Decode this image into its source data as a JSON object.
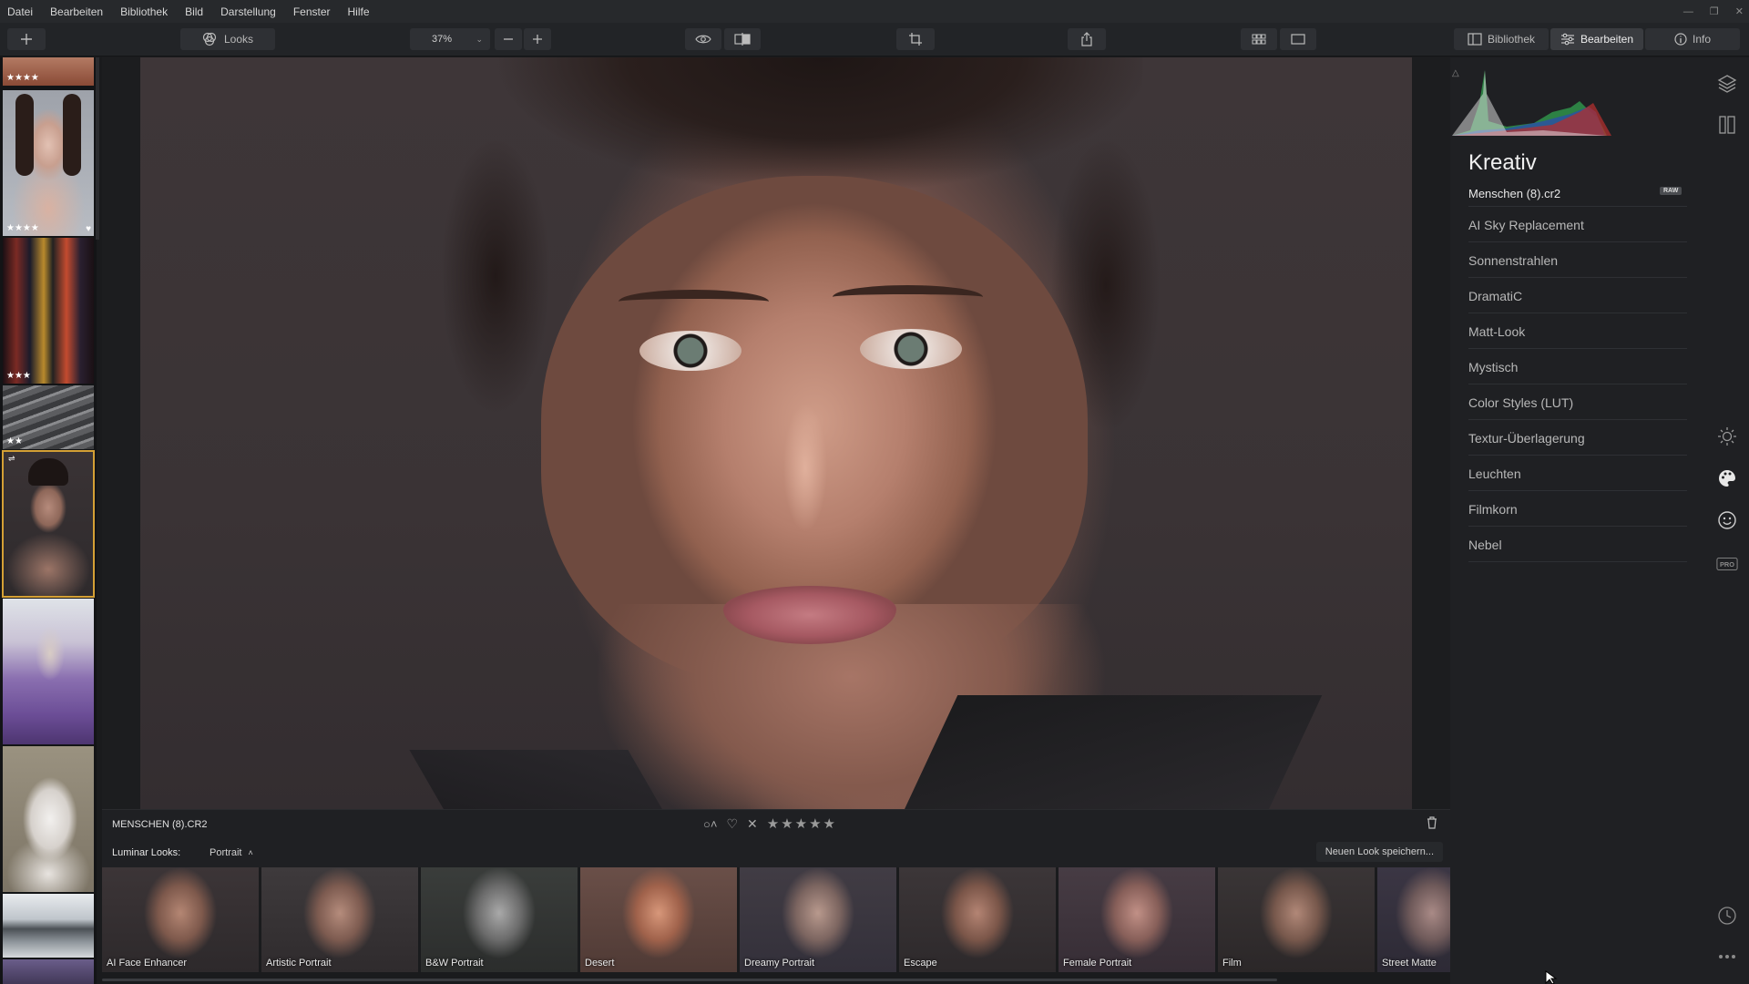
{
  "menu": [
    "Datei",
    "Bearbeiten",
    "Bibliothek",
    "Bild",
    "Darstellung",
    "Fenster",
    "Hilfe"
  ],
  "toolbar": {
    "looks_label": "Looks",
    "zoom_value": "37%",
    "mode_library": "Bibliothek",
    "mode_edit": "Bearbeiten",
    "mode_info": "Info"
  },
  "filmstrip": [
    {
      "stars": "★★★★",
      "selected": false
    },
    {
      "stars": "★★★★",
      "heart": "♥",
      "selected": false
    },
    {
      "stars": "★★★",
      "selected": false
    },
    {
      "stars": "★★",
      "selected": false
    },
    {
      "stars": "",
      "selected": true
    },
    {
      "stars": "",
      "selected": false
    },
    {
      "stars": "",
      "selected": false
    },
    {
      "stars": "",
      "selected": false
    },
    {
      "stars": "",
      "selected": false
    }
  ],
  "infobar": {
    "filename": "MENSCHEN (8).CR2"
  },
  "looksbar": {
    "label": "Luminar Looks:",
    "category": "Portrait",
    "save_button": "Neuen Look speichern..."
  },
  "looks": [
    {
      "name": "AI Face Enhancer"
    },
    {
      "name": "Artistic Portrait"
    },
    {
      "name": "B&W Portrait"
    },
    {
      "name": "Desert"
    },
    {
      "name": "Dreamy Portrait"
    },
    {
      "name": "Escape"
    },
    {
      "name": "Female Portrait"
    },
    {
      "name": "Film"
    },
    {
      "name": "Street Matte"
    }
  ],
  "panel": {
    "title": "Kreativ",
    "filename": "Menschen (8).cr2",
    "raw_badge": "RAW",
    "tools": [
      "AI Sky Replacement",
      "Sonnenstrahlen",
      "DramatiC",
      "Matt-Look",
      "Mystisch",
      "Color Styles (LUT)",
      "Textur-Überlagerung",
      "Leuchten",
      "Filmkorn",
      "Nebel"
    ]
  },
  "sidebar_icons": [
    "layers-icon",
    "library-panel-icon",
    "sun-icon",
    "palette-icon",
    "smiley-icon",
    "pro-badge-icon",
    "history-icon",
    "more-icon"
  ],
  "colors": {
    "accent_selected": "#d4a035",
    "background": "#1a1b1d"
  }
}
